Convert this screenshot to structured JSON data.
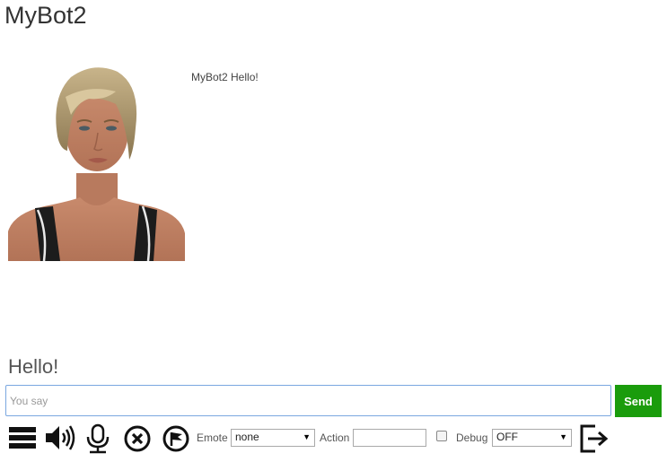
{
  "app": {
    "title": "MyBot2"
  },
  "conversation": {
    "bot_message": "MyBot2 Hello!",
    "response_text": "Hello!"
  },
  "chat": {
    "placeholder": "You say",
    "value": "",
    "send_label": "Send"
  },
  "toolbar": {
    "icons": [
      "menu-icon",
      "speaker-icon",
      "microphone-icon",
      "cancel-icon",
      "flag-icon",
      "exit-icon"
    ],
    "emote_label": "Emote",
    "emote_value": "none",
    "action_label": "Action",
    "action_value": "",
    "debug_label": "Debug",
    "debug_checked": false,
    "debug_level_value": "OFF"
  },
  "colors": {
    "send_bg": "#1a9c0c",
    "input_border": "#7aa7e0"
  }
}
